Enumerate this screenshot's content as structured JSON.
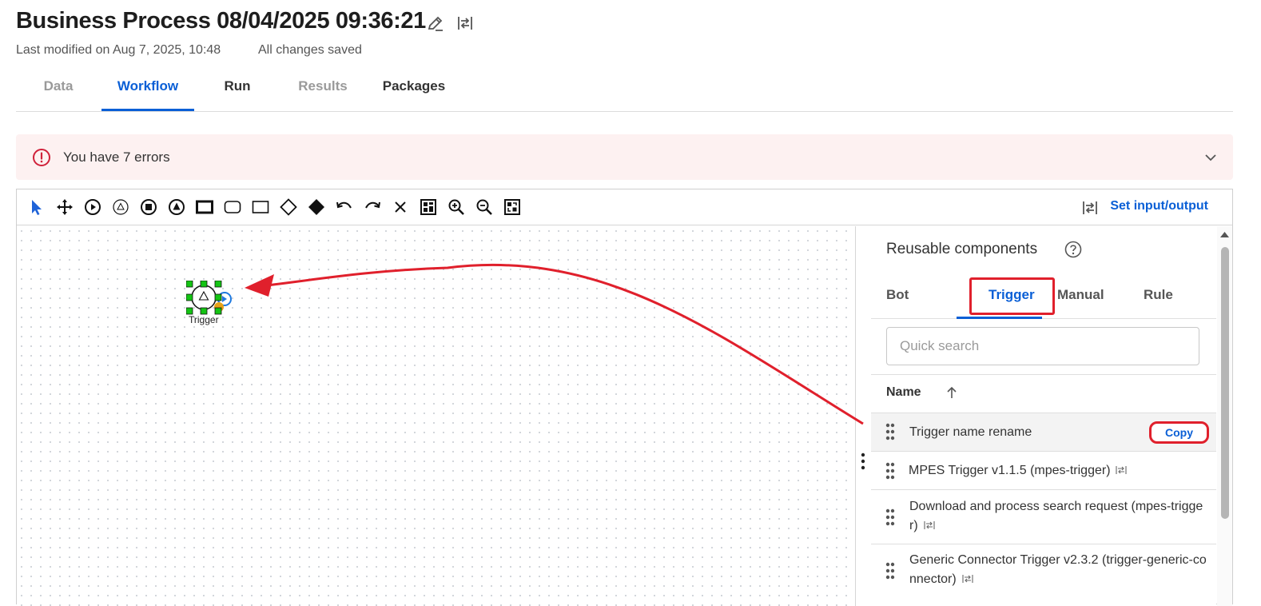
{
  "header": {
    "title": "Business Process 08/04/2025 09:36:21",
    "last_modified": "Last modified on Aug 7, 2025, 10:48",
    "save_status": "All changes saved"
  },
  "tabs": [
    {
      "label": "Data"
    },
    {
      "label": "Workflow"
    },
    {
      "label": "Run"
    },
    {
      "label": "Results"
    },
    {
      "label": "Packages"
    }
  ],
  "banner": {
    "text": "You have 7 errors"
  },
  "toolbar": {
    "set_io_label": "Set input/output",
    "tools": [
      "select-pointer-icon",
      "move-icon",
      "start-event-icon",
      "trigger-event-icon",
      "end-event-icon",
      "signal-event-icon",
      "subprocess-icon",
      "rounded-task-icon",
      "task-icon",
      "gateway-icon",
      "filled-gateway-icon",
      "undo-icon",
      "redo-icon",
      "delete-icon",
      "layout-icon",
      "zoom-in-icon",
      "zoom-out-icon",
      "fit-view-icon"
    ]
  },
  "canvas": {
    "node_label": "Trigger"
  },
  "panel": {
    "title": "Reusable components",
    "tabs": [
      {
        "label": "Bot"
      },
      {
        "label": "Trigger"
      },
      {
        "label": "Manual"
      },
      {
        "label": "Rule"
      }
    ],
    "search_placeholder": "Quick search",
    "column_header": "Name",
    "copy_label": "Copy",
    "items": [
      {
        "line1": "Trigger name rename",
        "line2": ""
      },
      {
        "line1": "MPES Trigger v1.1.5 (mpes-trigger)",
        "line2": ""
      },
      {
        "line1": "Download and process search request (mpes-trigge",
        "line2": "r)"
      },
      {
        "line1": "Generic Connector Trigger v2.3.2 (trigger-generic-co",
        "line2": "nnector)"
      }
    ]
  },
  "colors": {
    "accent": "#0a5fd6",
    "error": "#e0202c",
    "banner_bg": "#fdf1f1"
  }
}
